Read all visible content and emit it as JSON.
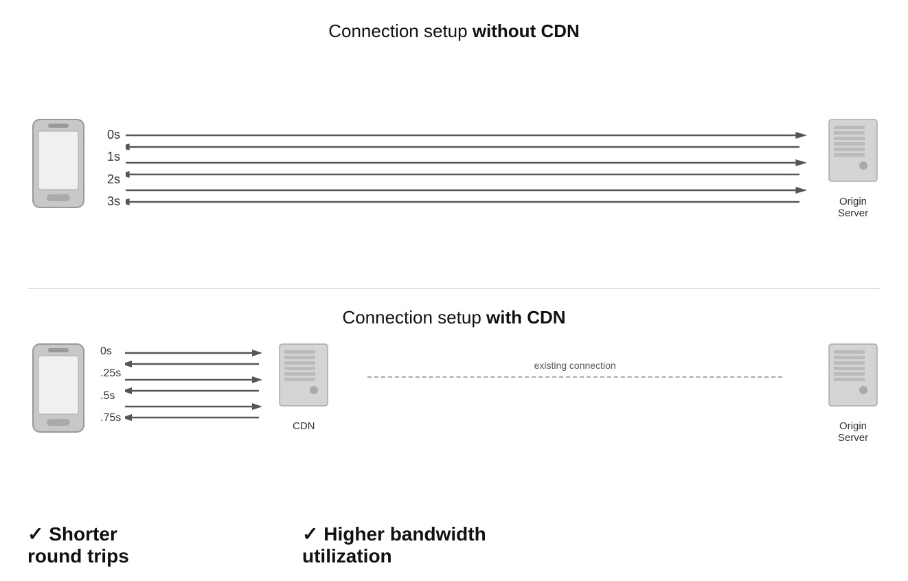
{
  "top": {
    "title_normal": "Connection setup ",
    "title_bold": "without CDN",
    "time_labels": [
      "0s",
      "1s",
      "2s",
      "3s"
    ],
    "server_label": "Origin\nServer"
  },
  "bottom": {
    "title_normal": "Connection setup ",
    "title_bold": "with CDN",
    "time_labels": [
      "0s",
      ".25s",
      ".5s",
      ".75s"
    ],
    "cdn_label": "CDN",
    "existing_connection": "existing connection",
    "server_label": "Origin\nServer",
    "benefit1_check": "✓",
    "benefit1_text": "Shorter\nround trips",
    "benefit2_check": "✓",
    "benefit2_text": "Higher bandwidth\nutilization"
  }
}
